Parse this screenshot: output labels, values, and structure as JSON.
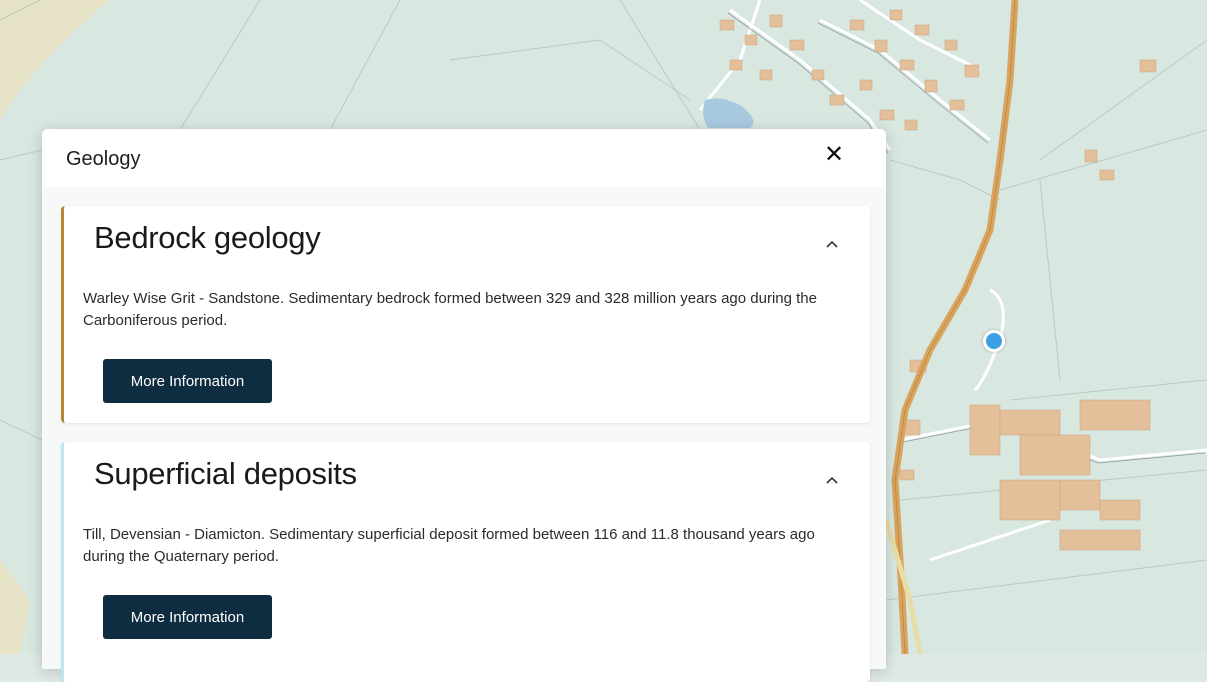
{
  "panel": {
    "title": "Geology",
    "close_icon": "close-icon"
  },
  "cards": [
    {
      "title": "Bedrock geology",
      "description": "Warley Wise Grit - Sandstone. Sedimentary bedrock formed between 329 and 328 million years ago during the Carboniferous period.",
      "button_label": "More Information",
      "accent": "#b08a3a",
      "chevron_icon": "chevron-up-icon"
    },
    {
      "title": "Superficial deposits",
      "description": "Till, Devensian - Diamicton. Sedimentary superficial deposit formed between 116 and 11.8 thousand years ago during the Quaternary period.",
      "button_label": "More Information",
      "accent": "#b9e6f3",
      "chevron_icon": "chevron-up-icon"
    }
  ],
  "colors": {
    "map_background": "#d9e7e1",
    "road": "#d9a55e",
    "building": "#e3c09a",
    "location_dot": "#3d9fe3",
    "button": "#0e2d40"
  }
}
